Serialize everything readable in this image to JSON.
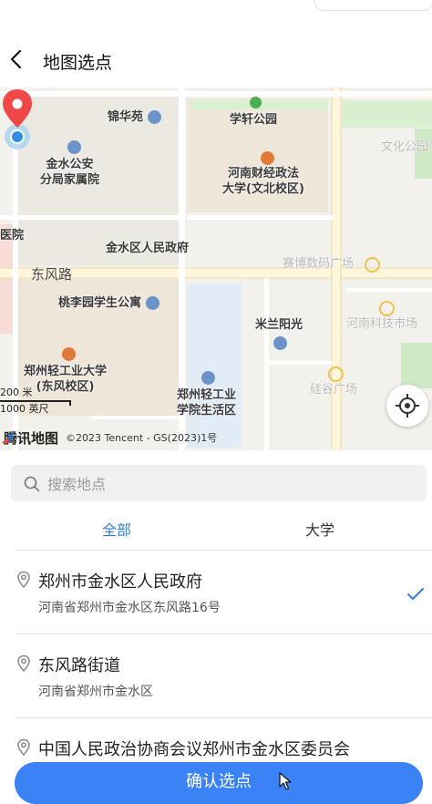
{
  "header": {
    "title": "地图选点"
  },
  "map": {
    "pois": [
      {
        "name": "锦华苑"
      },
      {
        "name": "学轩公园"
      },
      {
        "name": "文化公园"
      },
      {
        "name": "金水公安\n分局家属院"
      },
      {
        "name": "河南财经政法\n大学(文北校区)"
      },
      {
        "name": "医院"
      },
      {
        "name": "金水区人民政府"
      },
      {
        "name": "赛博数码广场"
      },
      {
        "name": "桃李园学生公寓"
      },
      {
        "name": "米兰阳光"
      },
      {
        "name": "河南科技市场"
      },
      {
        "name": "郑州轻工业大学\n(东风校区)"
      },
      {
        "name": "郑州轻工业\n学院生活区"
      },
      {
        "name": "硅谷广场"
      }
    ],
    "road": "东风路",
    "scale_metric": "200 米",
    "scale_imperial": "1000 英尺",
    "brand_name": "腾讯地图",
    "copyright": "©2023 Tencent - GS(2023)1号"
  },
  "search": {
    "placeholder": "搜索地点"
  },
  "tabs": [
    {
      "label": "全部"
    },
    {
      "label": "大学"
    }
  ],
  "results": [
    {
      "name": "郑州市金水区人民政府",
      "address": "河南省郑州市金水区东风路16号",
      "selected": true
    },
    {
      "name": "东风路街道",
      "address": "河南省郑州市金水区"
    },
    {
      "name": "中国人民政治协商会议郑州市金水区委员会",
      "address": ""
    }
  ],
  "confirm_label": "确认选点",
  "colors": {
    "accent": "#3b82f6",
    "tab_active": "#3a7bd5",
    "pin": "#f04848"
  }
}
